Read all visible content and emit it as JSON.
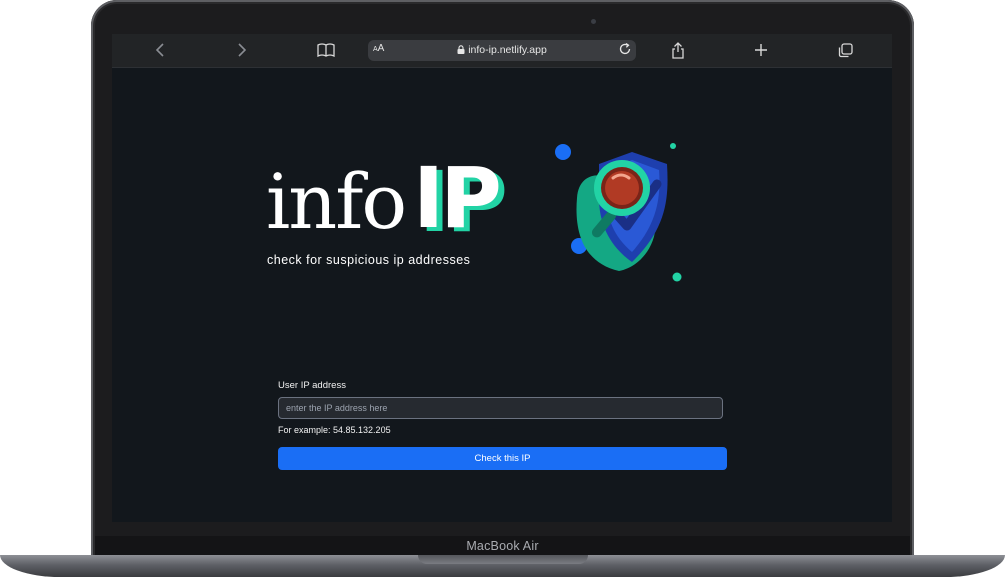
{
  "browser": {
    "aa_label": "AA",
    "url": "info-ip.netlify.app"
  },
  "hero": {
    "logo_text": "info",
    "logo_accent": "IP",
    "tagline": "check for suspicious ip addresses"
  },
  "form": {
    "label": "User IP address",
    "placeholder": "enter the IP address here",
    "value": "",
    "example": "For example: 54.85.132.205",
    "button_label": "Check this IP"
  },
  "device": {
    "label": "MacBook Air"
  },
  "colors": {
    "background": "#12171c",
    "accent": "#22d3a5",
    "button": "#1a6ef5",
    "shield": "#1e3fae"
  },
  "icons": [
    "back-icon",
    "forward-icon",
    "reader-icon",
    "lock-icon",
    "reload-icon",
    "share-icon",
    "new-tab-icon",
    "tabs-icon"
  ]
}
